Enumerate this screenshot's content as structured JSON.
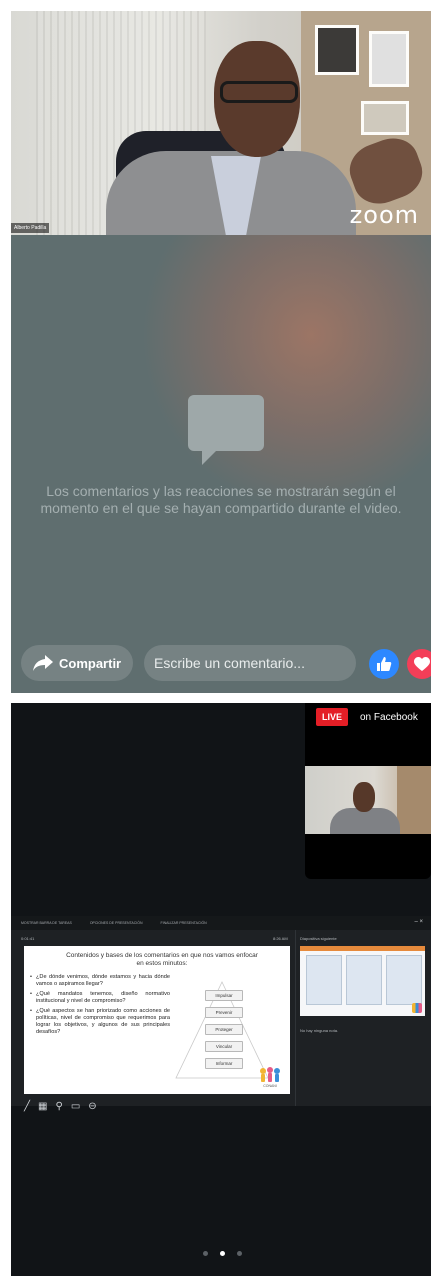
{
  "top_panel": {
    "video": {
      "participant_name": "Alberto Padilla",
      "watermark": "zoom"
    },
    "comments": {
      "icon": "chat-bubble-icon",
      "empty_message": "Los comentarios y las reacciones se mostrarán según el momento en el que se hayan compartido durante el video."
    },
    "actions": {
      "share_label": "Compartir",
      "share_icon": "share-arrow-icon",
      "comment_placeholder": "Escribe un comentario...",
      "like_icon": "thumbs-up-icon",
      "love_icon": "heart-icon"
    }
  },
  "bottom_panel": {
    "live": {
      "badge": "LIVE",
      "platform": "on Facebook"
    },
    "presenter": {
      "toolbar": [
        "MOSTRAR BARRA DE TAREAS",
        "OPCIONES DE PRESENTACIÓN",
        "FINALIZAR PRESENTACIÓN"
      ],
      "timer": "0:01:41",
      "clock": "8:26 AM",
      "next_label": "Diapositiva siguiente",
      "notes": "No hay ninguna nota.",
      "slide": {
        "title": "Contenidos y bases de los comentarios en que nos vamos enfocar en estos minutos:",
        "bullets": [
          "¿De dónde venimos, dónde estamos y hacia dónde vamos o aspiramos llegar?",
          "¿Qué mandatos tenemos, diseño normativo institucional y nivel de compromiso?",
          "¿Qué aspectos se han priorizado como acciones de políticas, nivel de compromiso que requerimos para lograr los objetivos, y algunos de sus principales desafíos?"
        ],
        "pyramid": [
          "Impulsar",
          "Prevenir",
          "Proteger",
          "Vincular",
          "Informar"
        ],
        "logo_text": "CONANI"
      },
      "tools": [
        "pen-icon",
        "slides-grid-icon",
        "zoom-magnifier-icon",
        "screen-icon",
        "more-icon"
      ]
    },
    "pagination": {
      "count": 3,
      "active": 1
    }
  },
  "colors": {
    "facebook_blue": "#2d88ff",
    "love_red": "#f33e58",
    "live_red": "#e41e26",
    "zoom_bg": "#111417"
  }
}
